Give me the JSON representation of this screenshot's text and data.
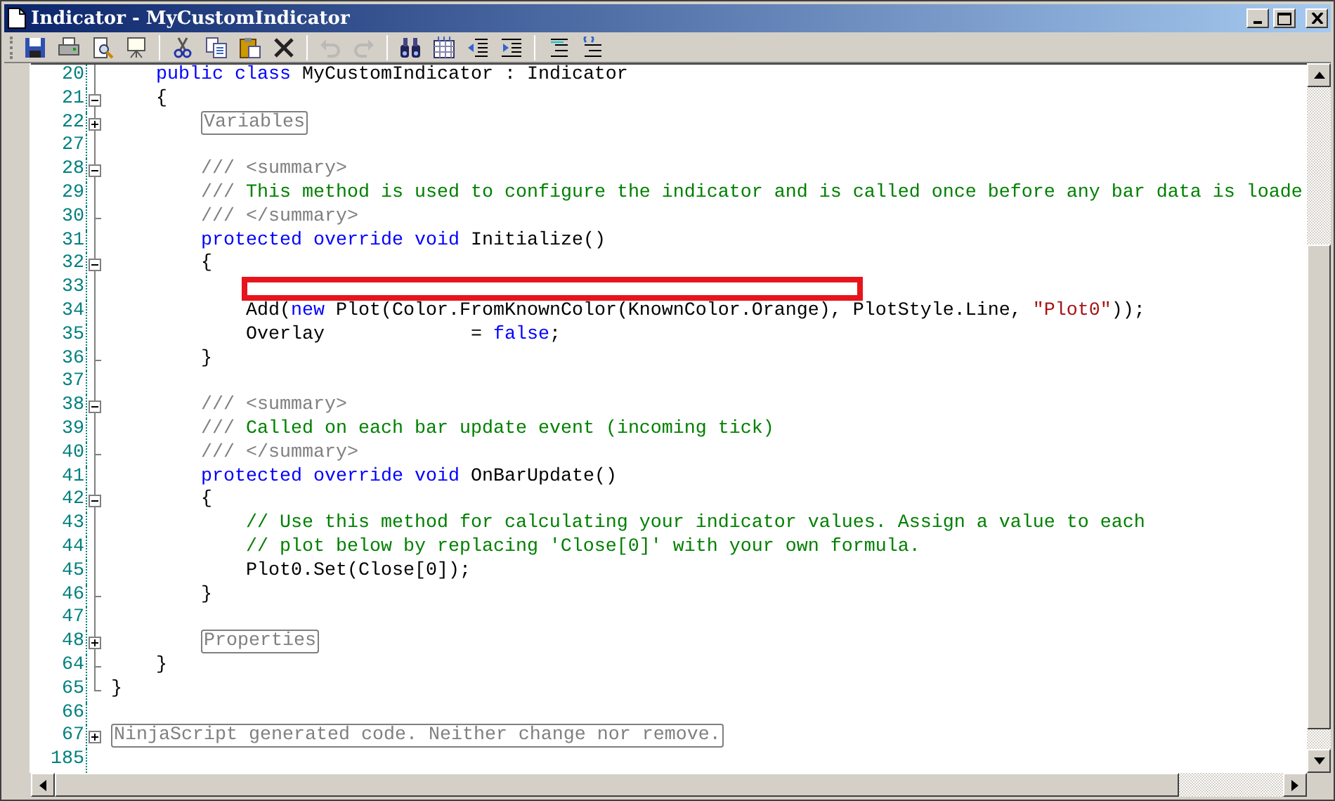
{
  "window": {
    "title": "Indicator - MyCustomIndicator"
  },
  "toolbar": [
    {
      "kind": "save",
      "disabled": false
    },
    {
      "kind": "print",
      "disabled": false
    },
    {
      "kind": "preview",
      "disabled": false
    },
    {
      "kind": "board",
      "disabled": false
    },
    {
      "kind": "sep"
    },
    {
      "kind": "cut",
      "disabled": false
    },
    {
      "kind": "copy",
      "disabled": false
    },
    {
      "kind": "paste",
      "disabled": false
    },
    {
      "kind": "delete",
      "disabled": false
    },
    {
      "kind": "sep"
    },
    {
      "kind": "undo",
      "disabled": true
    },
    {
      "kind": "redo",
      "disabled": true
    },
    {
      "kind": "sep"
    },
    {
      "kind": "find",
      "disabled": false
    },
    {
      "kind": "grid",
      "disabled": false
    },
    {
      "kind": "outdent",
      "disabled": false
    },
    {
      "kind": "indent",
      "disabled": false
    },
    {
      "kind": "sep"
    },
    {
      "kind": "comment",
      "disabled": false
    },
    {
      "kind": "uncomment",
      "disabled": false
    }
  ],
  "lines": [
    {
      "number": "20",
      "kind": "code",
      "marked": false,
      "segments": [
        {
          "kind": "keyword",
          "text": "    public class"
        },
        {
          "kind": "plain",
          "text": " MyCustomIndicator : Indicator"
        }
      ]
    },
    {
      "number": "21",
      "kind": "fold-start",
      "expanded": true,
      "marked": false,
      "segments": [
        {
          "kind": "plain",
          "text": "    {"
        }
      ]
    },
    {
      "number": "22",
      "kind": "fold-start",
      "expanded": false,
      "marked": false,
      "segments": [
        {
          "kind": "region",
          "text": "        Variables"
        }
      ]
    },
    {
      "number": "27",
      "kind": "code",
      "marked": false
    },
    {
      "number": "28",
      "kind": "fold-start",
      "expanded": true,
      "marked": false,
      "segments": [
        {
          "kind": "doc",
          "text": "        /// <summary>"
        }
      ]
    },
    {
      "number": "29",
      "kind": "code",
      "marked": false,
      "segments": [
        {
          "kind": "doc",
          "text": "        ///"
        },
        {
          "kind": "comment",
          "text": " This method is used to configure the indicator and is called once before any bar data is loade"
        }
      ]
    },
    {
      "number": "30",
      "kind": "fold-end",
      "marked": false,
      "segments": [
        {
          "kind": "doc",
          "text": "        /// </summary>"
        }
      ]
    },
    {
      "number": "31",
      "kind": "code",
      "marked": false,
      "segments": [
        {
          "kind": "keyword",
          "text": "        protected override void"
        },
        {
          "kind": "plain",
          "text": " Initialize()"
        }
      ]
    },
    {
      "number": "32",
      "kind": "fold-start",
      "expanded": true,
      "marked": false,
      "segments": [
        {
          "kind": "plain",
          "text": "        {"
        }
      ]
    },
    {
      "number": "33",
      "kind": "code",
      "marked": true
    },
    {
      "number": "34",
      "kind": "code",
      "marked": false,
      "segments": [
        {
          "kind": "plain",
          "text": "            Add("
        },
        {
          "kind": "keyword",
          "text": "new"
        },
        {
          "kind": "plain",
          "text": " Plot(Color.FromKnownColor(KnownColor.Orange), PlotStyle.Line, "
        },
        {
          "kind": "string",
          "text": "\"Plot0\""
        },
        {
          "kind": "plain",
          "text": "));"
        }
      ]
    },
    {
      "number": "35",
      "kind": "code",
      "marked": false,
      "segments": [
        {
          "kind": "plain",
          "text": "            Overlay             = "
        },
        {
          "kind": "keyword",
          "text": "false"
        },
        {
          "kind": "plain",
          "text": ";"
        }
      ]
    },
    {
      "number": "36",
      "kind": "fold-end",
      "marked": false,
      "segments": [
        {
          "kind": "plain",
          "text": "        }"
        }
      ]
    },
    {
      "number": "37",
      "kind": "code",
      "marked": false
    },
    {
      "number": "38",
      "kind": "fold-start",
      "expanded": true,
      "marked": false,
      "segments": [
        {
          "kind": "doc",
          "text": "        /// <summary>"
        }
      ]
    },
    {
      "number": "39",
      "kind": "code",
      "marked": false,
      "segments": [
        {
          "kind": "doc",
          "text": "        ///"
        },
        {
          "kind": "comment",
          "text": " Called on each bar update event (incoming tick)"
        }
      ]
    },
    {
      "number": "40",
      "kind": "fold-end",
      "marked": false,
      "segments": [
        {
          "kind": "doc",
          "text": "        /// </summary>"
        }
      ]
    },
    {
      "number": "41",
      "kind": "code",
      "marked": false,
      "segments": [
        {
          "kind": "keyword",
          "text": "        protected override void"
        },
        {
          "kind": "plain",
          "text": " OnBarUpdate()"
        }
      ]
    },
    {
      "number": "42",
      "kind": "fold-start",
      "expanded": true,
      "marked": false,
      "segments": [
        {
          "kind": "plain",
          "text": "        {"
        }
      ]
    },
    {
      "number": "43",
      "kind": "code",
      "marked": false,
      "segments": [
        {
          "kind": "comment",
          "text": "            // Use this method for calculating your indicator values. Assign a value to each"
        }
      ]
    },
    {
      "number": "44",
      "kind": "code",
      "marked": false,
      "segments": [
        {
          "kind": "comment",
          "text": "            // plot below by replacing 'Close[0]' with your own formula."
        }
      ]
    },
    {
      "number": "45",
      "kind": "code",
      "marked": false,
      "segments": [
        {
          "kind": "plain",
          "text": "            Plot0.Set(Close[0]);"
        }
      ]
    },
    {
      "number": "46",
      "kind": "fold-end",
      "marked": false,
      "segments": [
        {
          "kind": "plain",
          "text": "        }"
        }
      ]
    },
    {
      "number": "47",
      "kind": "code",
      "marked": false
    },
    {
      "number": "48",
      "kind": "fold-start",
      "expanded": false,
      "marked": false,
      "segments": [
        {
          "kind": "region",
          "text": "        Properties"
        }
      ]
    },
    {
      "number": "64",
      "kind": "fold-end",
      "marked": false,
      "segments": [
        {
          "kind": "plain",
          "text": "    }"
        }
      ]
    },
    {
      "number": "65",
      "kind": "fold-last",
      "marked": false,
      "segments": [
        {
          "kind": "plain",
          "text": "}"
        }
      ]
    },
    {
      "number": "66",
      "kind": "code",
      "marked": false
    },
    {
      "number": "67",
      "kind": "fold-start",
      "expanded": false,
      "marked": false,
      "segments": [
        {
          "kind": "region",
          "text": "NinjaScript generated code. Neither change nor remove."
        }
      ]
    },
    {
      "number": "185",
      "kind": "code",
      "marked": false
    }
  ]
}
